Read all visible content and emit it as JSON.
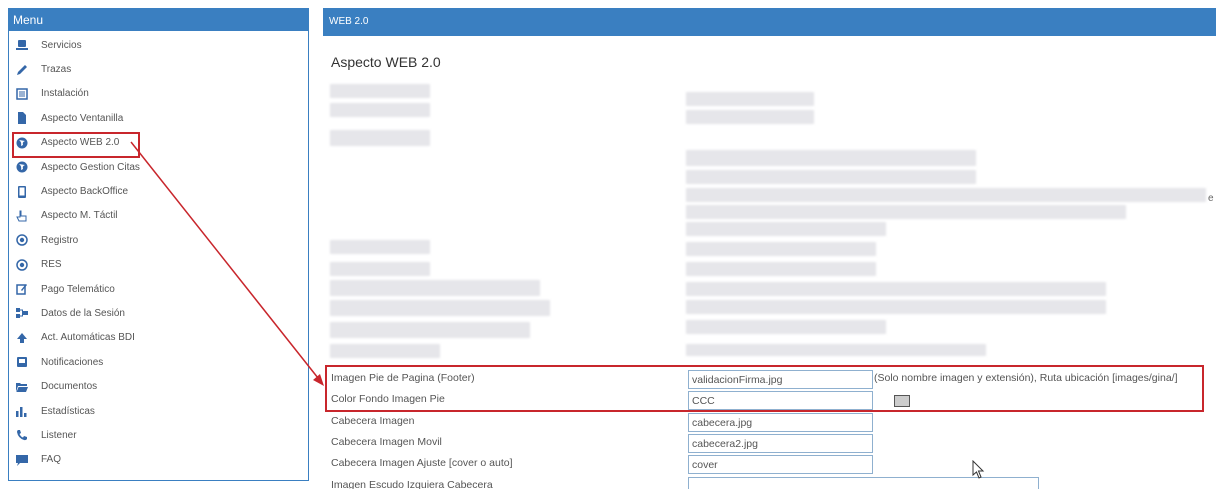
{
  "sidebar": {
    "title": "Menu",
    "items": [
      {
        "label": "Servicios",
        "icon": "laptop-icon"
      },
      {
        "label": "Trazas",
        "icon": "pencil-icon"
      },
      {
        "label": "Instalación",
        "icon": "list-icon"
      },
      {
        "label": "Aspecto Ventanilla",
        "icon": "file-icon"
      },
      {
        "label": "Aspecto WEB 2.0",
        "icon": "globe-icon"
      },
      {
        "label": "Aspecto Gestion Citas",
        "icon": "globe-icon"
      },
      {
        "label": "Aspecto BackOffice",
        "icon": "tablet-icon"
      },
      {
        "label": "Aspecto M. Táctil",
        "icon": "hand-pointer-icon"
      },
      {
        "label": "Registro",
        "icon": "circle-dot-icon"
      },
      {
        "label": "RES",
        "icon": "circle-dot-icon"
      },
      {
        "label": "Pago Telemático",
        "icon": "edit-icon"
      },
      {
        "label": "Datos de la Sesión",
        "icon": "sitemap-icon"
      },
      {
        "label": "Act. Automáticas BDI",
        "icon": "cloud-icon"
      },
      {
        "label": "Notificaciones",
        "icon": "inbox-icon"
      },
      {
        "label": "Documentos",
        "icon": "folder-icon"
      },
      {
        "label": "Estadísticas",
        "icon": "bar-chart-icon"
      },
      {
        "label": "Listener",
        "icon": "phone-icon"
      },
      {
        "label": "FAQ",
        "icon": "comment-icon"
      }
    ]
  },
  "main": {
    "header": "WEB 2.0",
    "title": "Aspecto WEB 2.0",
    "edge_char": "e",
    "rows": [
      {
        "label": "Imagen Pie de Pagina (Footer)",
        "value": "validacionFirma.jpg",
        "hint": "(Solo nombre imagen y extensión), Ruta ubicación [images/gina/]"
      },
      {
        "label": "Color Fondo Imagen Pie",
        "value": "CCC",
        "swatch_color": "#cccccc"
      },
      {
        "label": "Cabecera Imagen",
        "value": "cabecera.jpg"
      },
      {
        "label": "Cabecera Imagen Movil",
        "value": "cabecera2.jpg"
      },
      {
        "label": "Cabecera Imagen Ajuste [cover o auto]",
        "value": "cover"
      },
      {
        "label": "Imagen Escudo Izquiera Cabecera",
        "value": ""
      }
    ]
  },
  "colors": {
    "accent": "#3a7fc1",
    "highlight": "#c8262c"
  }
}
